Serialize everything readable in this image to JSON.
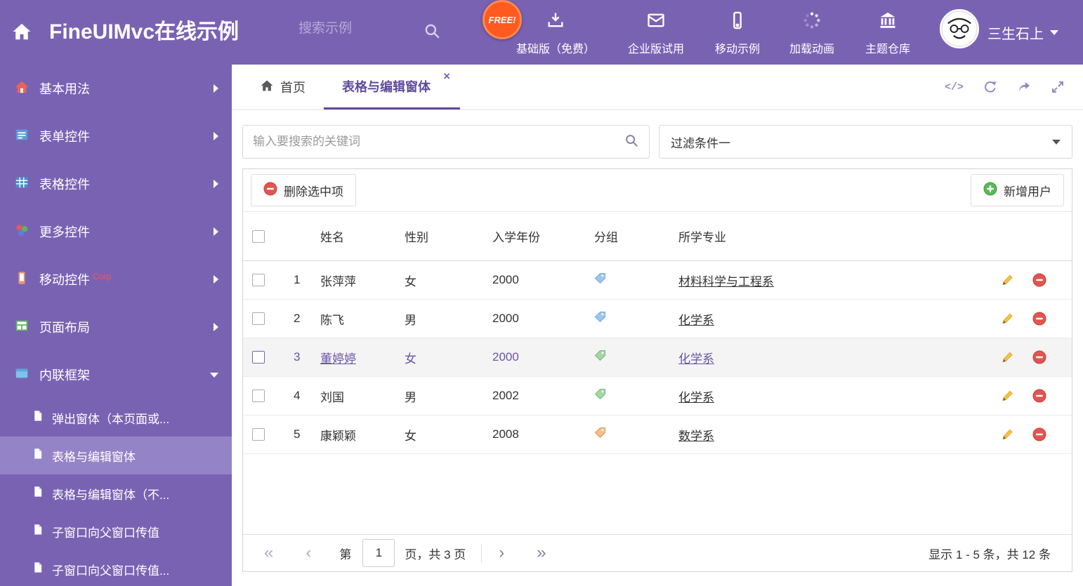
{
  "colors": {
    "brand_purple": "#7A62B3",
    "sidebar_selected": "#9583C7",
    "active_tab_purple": "#5F4B9E",
    "free_badge_orange": "#FF5A1F",
    "corp_red": "#FF5252",
    "delete_red": "#E25450",
    "add_green": "#57B957",
    "pencil_yellow": "#F5C242",
    "tag_blue": "#9EC7EE",
    "tag_green": "#A5D6A5",
    "tag_orange": "#F6BE88"
  },
  "icons": {
    "first": "«",
    "prev": "‹",
    "next": "›",
    "last": "»",
    "close": "×",
    "code": "</>"
  },
  "header": {
    "title": "FineUIMvc在线示例",
    "search_placeholder": "搜索示例",
    "free_badge": "FREE!",
    "nav": [
      {
        "label": "基础版（免费）"
      },
      {
        "label": "企业版试用"
      },
      {
        "label": "移动示例"
      },
      {
        "label": "加载动画"
      },
      {
        "label": "主题仓库"
      }
    ],
    "user_name": "三生石上"
  },
  "sidebar": {
    "items": [
      {
        "label": "基本用法"
      },
      {
        "label": "表单控件"
      },
      {
        "label": "表格控件"
      },
      {
        "label": "更多控件"
      },
      {
        "label": "移动控件",
        "badge": "Corp."
      },
      {
        "label": "页面布局"
      },
      {
        "label": "内联框架"
      }
    ],
    "subitems": [
      {
        "label": "弹出窗体（本页面或..."
      },
      {
        "label": "表格与编辑窗体"
      },
      {
        "label": "表格与编辑窗体（不..."
      },
      {
        "label": "子窗口向父窗口传值"
      },
      {
        "label": "子窗口向父窗口传值..."
      }
    ]
  },
  "tabs": {
    "home_label": "首页",
    "active_label": "表格与编辑窗体"
  },
  "filter": {
    "search_placeholder": "输入要搜索的关键词",
    "dropdown_value": "过滤条件一"
  },
  "toolbar": {
    "delete_label": "删除选中项",
    "add_label": "新增用户"
  },
  "table": {
    "headers": [
      "姓名",
      "性别",
      "入学年份",
      "分组",
      "所学专业"
    ],
    "rows": [
      {
        "num": "1",
        "name": "张萍萍",
        "gender": "女",
        "year": "2000",
        "tag_color": "blue",
        "major": "材料科学与工程系",
        "selected": false
      },
      {
        "num": "2",
        "name": "陈飞",
        "gender": "男",
        "year": "2000",
        "tag_color": "blue",
        "major": "化学系",
        "selected": false
      },
      {
        "num": "3",
        "name": "董婷婷",
        "gender": "女",
        "year": "2000",
        "tag_color": "green",
        "major": "化学系",
        "selected": true
      },
      {
        "num": "4",
        "name": "刘国",
        "gender": "男",
        "year": "2002",
        "tag_color": "green",
        "major": "化学系",
        "selected": false
      },
      {
        "num": "5",
        "name": "康颖颖",
        "gender": "女",
        "year": "2008",
        "tag_color": "orange",
        "major": "数学系",
        "selected": false
      }
    ]
  },
  "pagination": {
    "page_label_before": "第",
    "page_value": "1",
    "page_label_after": "页，共 3 页",
    "summary": "显示 1 - 5 条，共 12 条"
  }
}
